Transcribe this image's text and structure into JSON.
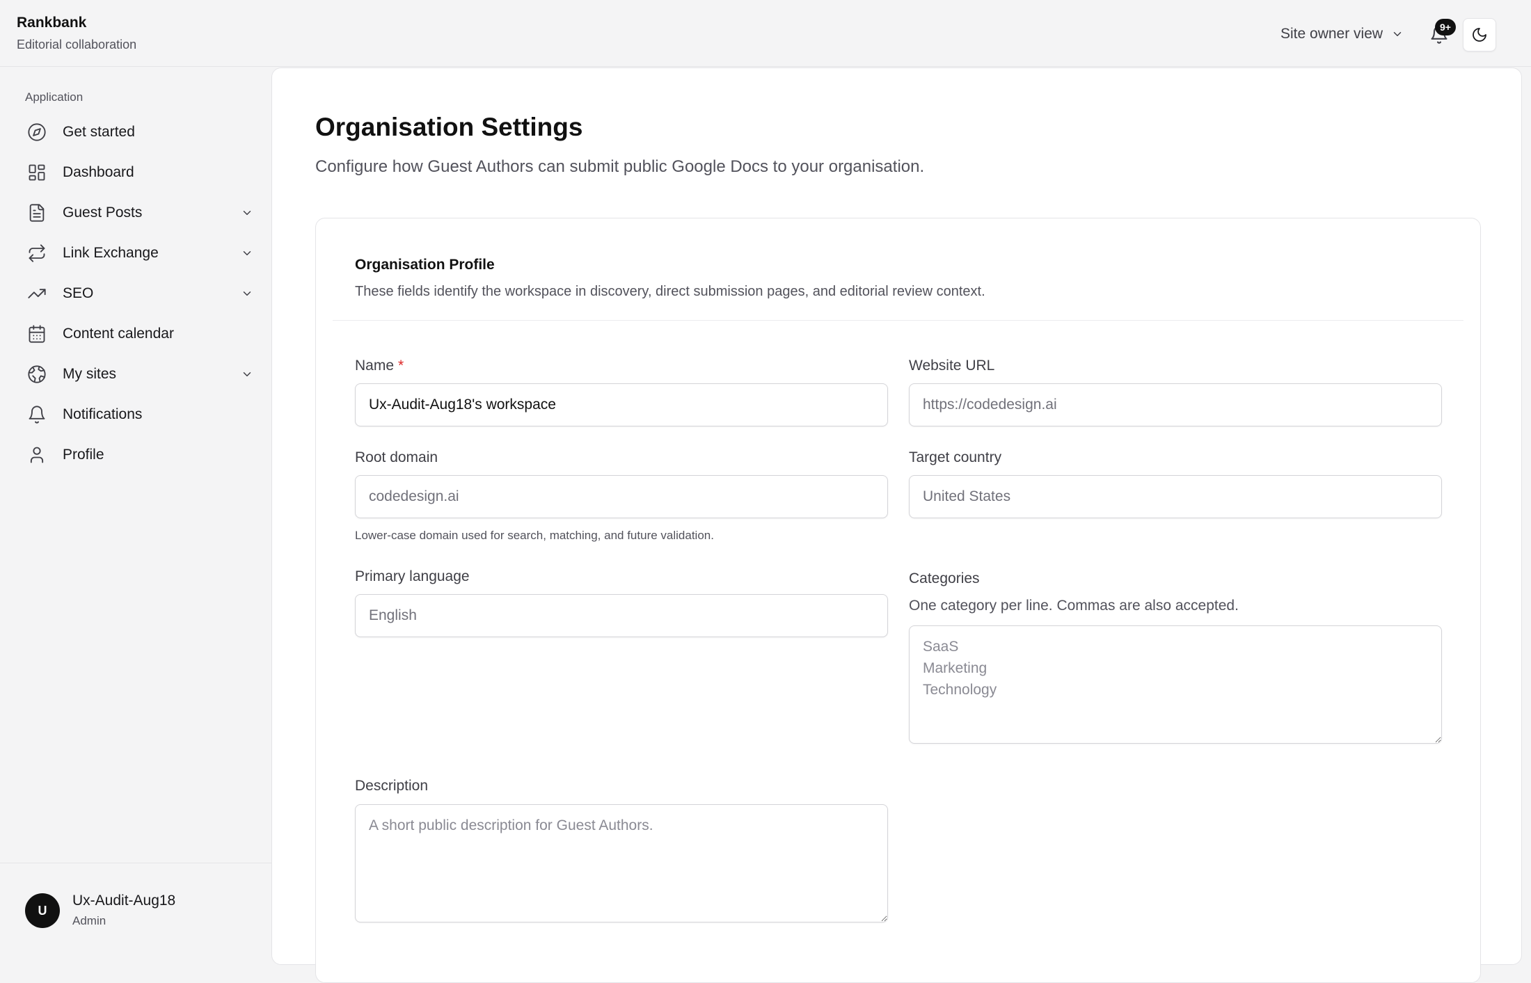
{
  "brand": {
    "title": "Rankbank",
    "subtitle": "Editorial collaboration"
  },
  "header": {
    "view_label": "Site owner view",
    "notification_badge": "9+"
  },
  "sidebar": {
    "section_label": "Application",
    "items": [
      {
        "label": "Get started",
        "icon": "compass-icon",
        "expandable": false
      },
      {
        "label": "Dashboard",
        "icon": "grid-icon",
        "expandable": false
      },
      {
        "label": "Guest Posts",
        "icon": "document-icon",
        "expandable": true
      },
      {
        "label": "Link Exchange",
        "icon": "repeat-icon",
        "expandable": true
      },
      {
        "label": "SEO",
        "icon": "trending-up-icon",
        "expandable": true
      },
      {
        "label": "Content calendar",
        "icon": "calendar-icon",
        "expandable": false
      },
      {
        "label": "My sites",
        "icon": "globe-icon",
        "expandable": true
      },
      {
        "label": "Notifications",
        "icon": "bell-icon",
        "expandable": false
      },
      {
        "label": "Profile",
        "icon": "user-icon",
        "expandable": false
      }
    ],
    "user": {
      "initial": "U",
      "name": "Ux-Audit-Aug18",
      "role": "Admin"
    }
  },
  "page": {
    "title": "Organisation Settings",
    "description": "Configure how Guest Authors can submit public Google Docs to your organisation."
  },
  "profile_card": {
    "title": "Organisation Profile",
    "description": "These fields identify the workspace in discovery, direct submission pages, and editorial review context.",
    "fields": {
      "name": {
        "label": "Name",
        "required_mark": "*",
        "value": "Ux-Audit-Aug18's workspace",
        "placeholder": ""
      },
      "website_url": {
        "label": "Website URL",
        "value": "",
        "placeholder": "https://codedesign.ai"
      },
      "root_domain": {
        "label": "Root domain",
        "value": "",
        "placeholder": "codedesign.ai",
        "hint": "Lower-case domain used for search, matching, and future validation."
      },
      "target_country": {
        "label": "Target country",
        "value": "",
        "placeholder": "United States"
      },
      "primary_language": {
        "label": "Primary language",
        "value": "",
        "placeholder": "English"
      },
      "categories": {
        "label": "Categories",
        "help": "One category per line. Commas are also accepted.",
        "value": "",
        "placeholder": "SaaS\nMarketing\nTechnology"
      },
      "description": {
        "label": "Description",
        "value": "",
        "placeholder": "A short public description for Guest Authors."
      }
    }
  },
  "colors": {
    "accent": "#111111",
    "required": "#dc2626",
    "muted_text": "#52525b",
    "border": "#d4d4d8"
  }
}
